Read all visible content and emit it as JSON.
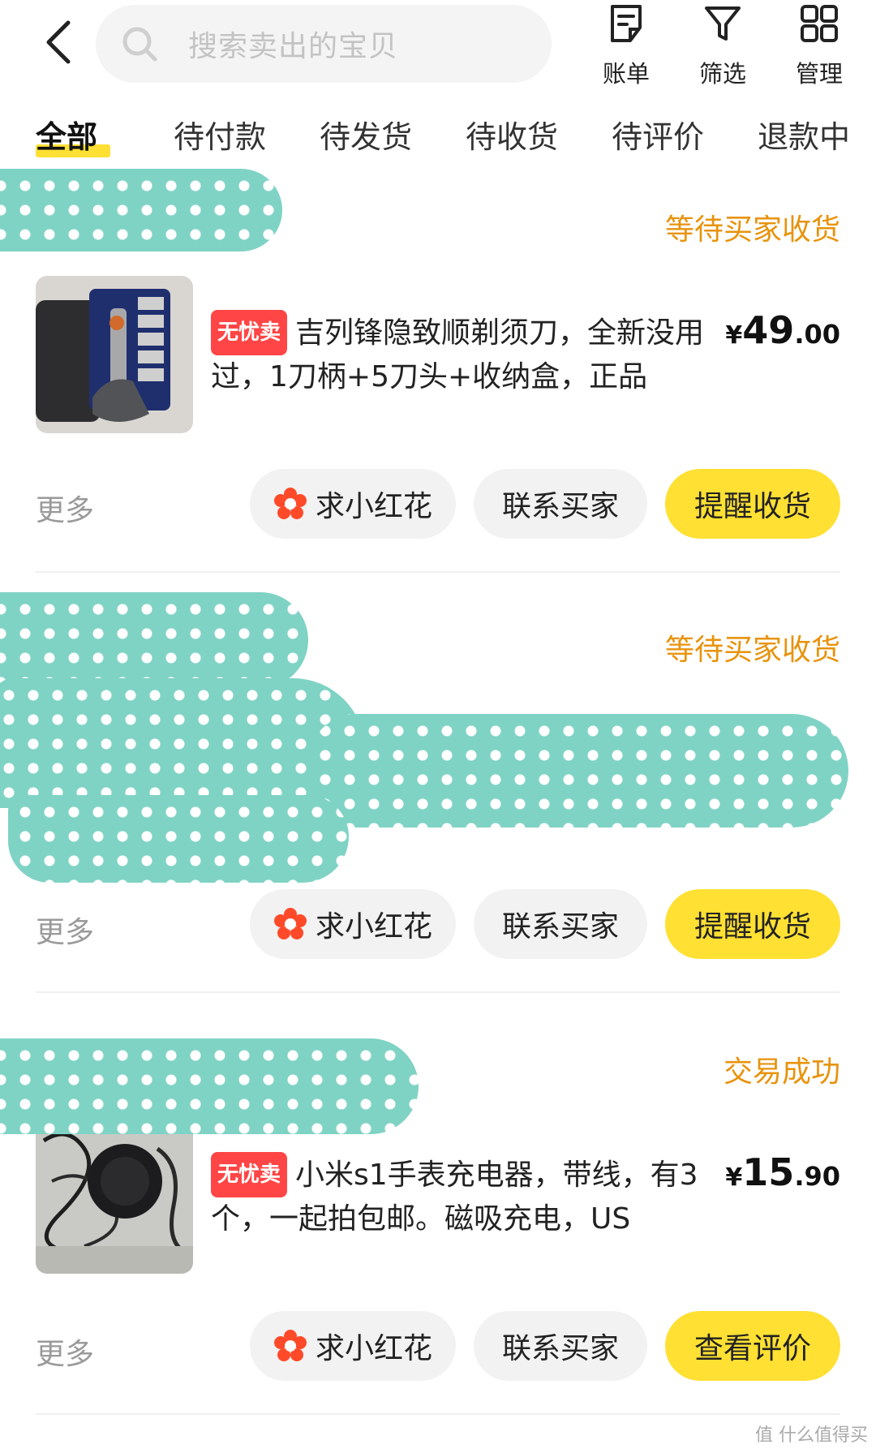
{
  "header": {
    "search_placeholder": "搜索卖出的宝贝",
    "tools": [
      {
        "label": "账单",
        "icon": "bill-icon"
      },
      {
        "label": "筛选",
        "icon": "filter-icon"
      },
      {
        "label": "管理",
        "icon": "grid-icon"
      }
    ]
  },
  "tabs": [
    "全部",
    "待付款",
    "待发货",
    "待收货",
    "待评价",
    "退款中"
  ],
  "orders": [
    {
      "status": "等待买家收货",
      "badge": "无忧卖",
      "title": "吉列锋隐致顺剃须刀，全新没用过，1刀柄+5刀头+收纳盒，正品",
      "price_currency": "¥",
      "price_int": "49",
      "price_dec": ".00",
      "more": "更多",
      "btn_flower": "求小红花",
      "btn_contact": "联系买家",
      "btn_primary": "提醒收货"
    },
    {
      "status": "等待买家收货",
      "more": "更多",
      "btn_flower": "求小红花",
      "btn_contact": "联系买家",
      "btn_primary": "提醒收货"
    },
    {
      "status": "交易成功",
      "badge": "无忧卖",
      "title": "小米s1手表充电器，带线，有3个，一起拍包邮。磁吸充电，US",
      "price_currency": "¥",
      "price_int": "15",
      "price_dec": ".90",
      "more": "更多",
      "btn_flower": "求小红花",
      "btn_contact": "联系买家",
      "btn_primary": "查看评价"
    }
  ],
  "watermark": "值 什么值得买",
  "colors": {
    "accent_yellow": "#ffe033",
    "status_orange": "#e8930c",
    "badge_red": "#ff4545",
    "redaction_teal": "#7fd3c4"
  }
}
